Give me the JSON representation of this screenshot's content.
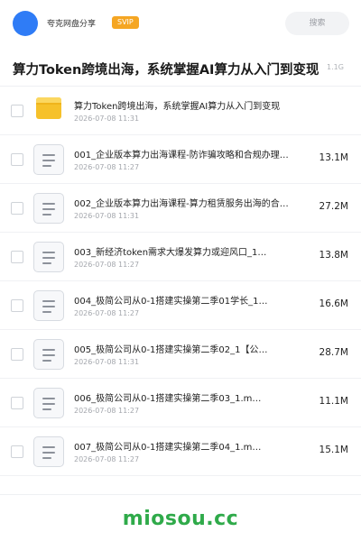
{
  "header": {
    "username": "夸克网盘分享",
    "badge": "SVIP",
    "search_placeholder": "搜索"
  },
  "share": {
    "title": "算力Token跨境出海，系统掌握AI算力从入门到变现",
    "total_size": "1.1G"
  },
  "folder": {
    "name": "算力Token跨境出海，系统掌握AI算力从入门到变现",
    "date": "2026-07-08 11:31"
  },
  "files": [
    {
      "name": "001_企业版本算力出海课程-防诈骗攻略和合规办理…",
      "date": "2026-07-08 11:27",
      "size": "13.1M"
    },
    {
      "name": "002_企业版本算力出海课程-算力租赁服务出海的合…",
      "date": "2026-07-08 11:31",
      "size": "27.2M"
    },
    {
      "name": "003_新经济token需求大爆发算力或迎风口_1…",
      "date": "2026-07-08 11:27",
      "size": "13.8M"
    },
    {
      "name": "004_极简公司从0-1搭建实操第二季01学长_1…",
      "date": "2026-07-08 11:27",
      "size": "16.6M"
    },
    {
      "name": "005_极简公司从0-1搭建实操第二季02_1【公…",
      "date": "2026-07-08 11:31",
      "size": "28.7M"
    },
    {
      "name": "006_极简公司从0-1搭建实操第二季03_1.m…",
      "date": "2026-07-08 11:27",
      "size": "11.1M"
    },
    {
      "name": "007_极简公司从0-1搭建实操第二季04_1.m…",
      "date": "2026-07-08 11:27",
      "size": "15.1M"
    }
  ],
  "watermark": "miosou.cc",
  "colors": {
    "avatar": "#2f7cf6",
    "svip": "#f5a623",
    "folder": "#f6c12a",
    "watermark": "#2faa4a"
  }
}
